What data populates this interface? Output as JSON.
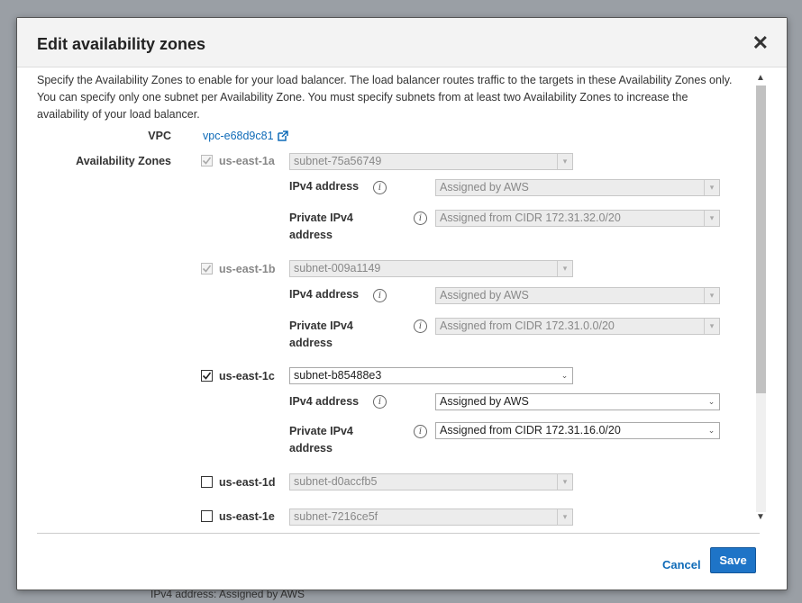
{
  "background": {
    "text": "IPv4 address: Assigned by AWS"
  },
  "modal": {
    "title": "Edit availability zones",
    "description": "Specify the Availability Zones to enable for your load balancer. The load balancer routes traffic to the targets in these Availability Zones only. You can specify only one subnet per Availability Zone. You must specify subnets from at least two Availability Zones to increase the availability of your load balancer.",
    "vpc_label": "VPC",
    "vpc_value": "vpc-e68d9c81",
    "az_label": "Availability Zones",
    "ipv4_label": "IPv4 address",
    "private_ipv4_label": "Private IPv4 address",
    "zones": [
      {
        "name": "us-east-1a",
        "checked": true,
        "disabled": true,
        "subnet": "subnet-75a56749",
        "ipv4": "Assigned by AWS",
        "private_ipv4": "Assigned from CIDR 172.31.32.0/20"
      },
      {
        "name": "us-east-1b",
        "checked": true,
        "disabled": true,
        "subnet": "subnet-009a1149",
        "ipv4": "Assigned by AWS",
        "private_ipv4": "Assigned from CIDR 172.31.0.0/20"
      },
      {
        "name": "us-east-1c",
        "checked": true,
        "disabled": false,
        "subnet": "subnet-b85488e3",
        "ipv4": "Assigned by AWS",
        "private_ipv4": "Assigned from CIDR 172.31.16.0/20"
      },
      {
        "name": "us-east-1d",
        "checked": false,
        "disabled": false,
        "subnet": "subnet-d0accfb5"
      },
      {
        "name": "us-east-1e",
        "checked": false,
        "disabled": false,
        "subnet": "subnet-7216ce5f"
      }
    ],
    "cancel_label": "Cancel",
    "save_label": "Save"
  },
  "colors": {
    "primary": "#1e74c7",
    "link": "#0f6bb8"
  }
}
